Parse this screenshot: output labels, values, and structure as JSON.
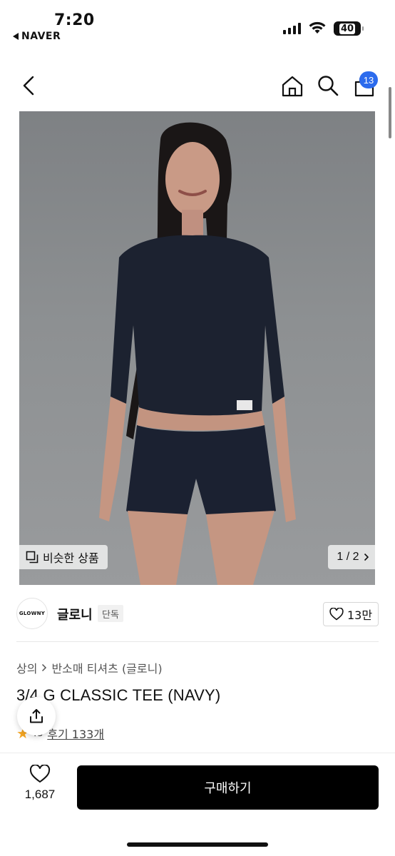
{
  "status_bar": {
    "time": "7:20",
    "back_app": "NAVER",
    "battery": "40"
  },
  "nav": {
    "cart_count": "13"
  },
  "gallery": {
    "similar_label": "비슷한 상품",
    "page_indicator": "1 / 2"
  },
  "brand": {
    "logo_text": "GLOWNY",
    "name": "글로니",
    "tag": "단독",
    "likes": "13만"
  },
  "product": {
    "breadcrumb": [
      "상의",
      "반소매 티셔츠 (글로니)"
    ],
    "title": "3/4 G CLASSIC TEE (NAVY)",
    "rating": ".8",
    "reviews": "후기 133개"
  },
  "bottom_bar": {
    "wish_count": "1,687",
    "buy_label": "구매하기"
  },
  "colors": {
    "badge": "#2c6bed",
    "buy_button": "#000000",
    "star": "#f5a623"
  }
}
